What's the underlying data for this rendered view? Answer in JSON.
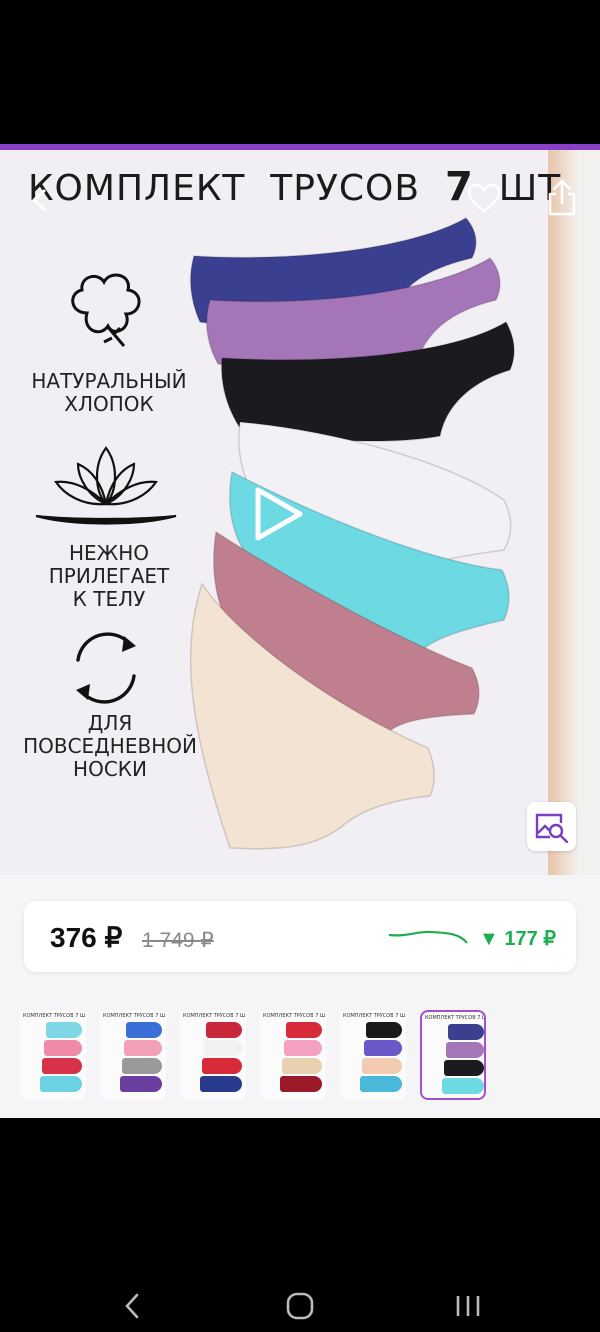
{
  "colors": {
    "accent": "#8a3fc8",
    "price_drop": "#1cae4f",
    "thumb_selected": "#a34fd0"
  },
  "product_image": {
    "headline_words": [
      "КОМПЛЕКТ",
      "ТРУСОВ",
      "7",
      "ШТ"
    ],
    "features": [
      {
        "icon": "cotton-icon",
        "lines": [
          "НАТУРАЛЬНЫЙ",
          "ХЛОПОК"
        ]
      },
      {
        "icon": "lotus-icon",
        "lines": [
          "НЕЖНО",
          "ПРИЛЕГАЕТ",
          "К ТЕЛУ"
        ]
      },
      {
        "icon": "cycle-icon",
        "lines": [
          "ДЛЯ",
          "ПОВСЕДНЕВНОЙ",
          "НОСКИ"
        ]
      }
    ],
    "panty_colors": [
      "#3a3f8f",
      "#a476b8",
      "#1a1a1f",
      "#f2f2f6",
      "#6dd9e3",
      "#c07f8e",
      "#f3e3d3"
    ]
  },
  "toolbar": {
    "back_icon": "back-arrow-icon",
    "favorite_icon": "heart-icon",
    "share_icon": "share-icon"
  },
  "price": {
    "current": "376 ₽",
    "old": "1 749 ₽",
    "drop": "▼ 177 ₽"
  },
  "thumbnails": [
    {
      "colors": [
        "#7fd7e6",
        "#ef8aa8",
        "#d6324a",
        "#6ad2e0"
      ]
    },
    {
      "colors": [
        "#3a6fd8",
        "#f2a0b8",
        "#9a9a9a",
        "#6a3fa0"
      ]
    },
    {
      "colors": [
        "#c9283a",
        "#f1f1f1",
        "#d82b3a",
        "#2a3a8c"
      ]
    },
    {
      "colors": [
        "#d82b3a",
        "#f4a0c0",
        "#e8d0b0",
        "#9a1a2a"
      ]
    },
    {
      "colors": [
        "#1a1a1a",
        "#6a58c8",
        "#f3cbb0",
        "#4ab8d8"
      ]
    },
    {
      "colors": [
        "#3a3f8f",
        "#a476b8",
        "#1a1a1f",
        "#6dd9e3"
      ]
    }
  ],
  "thumb_header": "КОМПЛЕКТ ТРУСОВ 7 ШТ",
  "system_nav": [
    "back-icon",
    "home-icon",
    "recents-icon"
  ]
}
